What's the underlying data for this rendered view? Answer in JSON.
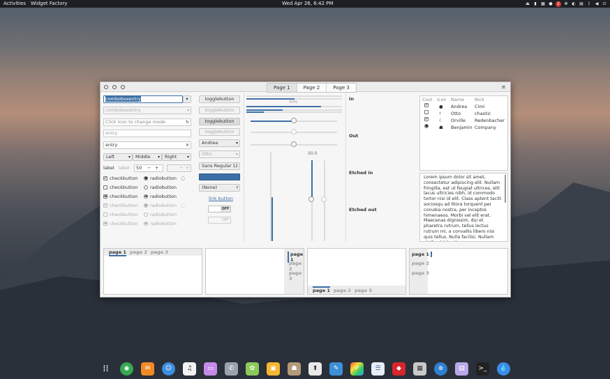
{
  "topbar": {
    "activities": "Activities",
    "app": "Widget Factory",
    "clock": "Wed Apr 26,  6:42 PM",
    "badge": "2"
  },
  "window": {
    "tabs": [
      "Page 1",
      "Page 2",
      "Page 3"
    ],
    "menu": "≡"
  },
  "col1": {
    "combo": "comboboxentry",
    "combo_dis": "comboboxentry",
    "icon_entry": "Click icon to change mode",
    "entry_ph": "entry",
    "entry": "entry",
    "combo_left": "Left",
    "combo_middle": "Middle",
    "combo_right": "Right",
    "label1": "label",
    "label2": "label",
    "spin": "50",
    "minus": "−",
    "plus": "+",
    "checks": [
      "checkbutton",
      "checkbutton",
      "checkbutton",
      "checkbutton",
      "checkbutton",
      "checkbutton"
    ],
    "radios": [
      "radiobutton",
      "radiobutton",
      "radiobutton",
      "radiobutton",
      "radiobutton",
      "radiobutton"
    ]
  },
  "col2": {
    "toggles": [
      "togglebutton",
      "togglebutton",
      "togglebutton",
      "togglebutton"
    ],
    "combo_andrea": "Andrea",
    "combo_otto": "Otto",
    "font": "Sans Regular",
    "font_size": "12",
    "file": "(None)",
    "link": "link button",
    "off1": "OFF",
    "off2": "OFF"
  },
  "col3": {
    "progress_label": "50%",
    "scale_value": "50.0"
  },
  "col4": {
    "frames": [
      "In",
      "Out",
      "Etched in",
      "Etched out"
    ]
  },
  "tree": {
    "headers": [
      "Cool",
      "Icon",
      "Name",
      "Nick"
    ],
    "rows": [
      {
        "cool": "✔",
        "icon": "●",
        "name": "Andrea",
        "nick": "Cimi"
      },
      {
        "cool": "",
        "icon": "!",
        "name": "Otto",
        "nick": "chaotic"
      },
      {
        "cool": "✔",
        "icon": "☾",
        "name": "Orville",
        "nick": "Redenbacher"
      },
      {
        "cool": "●",
        "icon": "☗",
        "name": "Benjamin",
        "nick": "Company"
      }
    ]
  },
  "lorem": "Lorem ipsum dolor sit amet, consectetur adipiscing elit. Nullam fringilla, est ut feugiat ultrices, elit lacus ultricies nibh, id commodo tortor nisi id elit. Class aptent taciti sociosqu ad litora torquent per conubia nostra, per inceptos himenaeos. Morbi vel elit erat. Maecenas dignissim, dui et pharetra rutrum, tellus lectus rutrum mi, a convallis libero nisi quis tellus. Nulla facilisi. Nullam eleifend lobortis",
  "notebooks": {
    "top": [
      "page 1",
      "page 2",
      "page 3"
    ],
    "right": [
      "page 1",
      "page 2",
      "page 3"
    ],
    "bottom": [
      "page 1",
      "page 2",
      "page 3"
    ],
    "left": [
      "page 1",
      "page 2",
      "page 3"
    ]
  },
  "dock": {
    "apps": [
      "apps-grid-icon",
      "browser-icon",
      "messages-icon",
      "chat-icon",
      "music-icon",
      "files-icon",
      "phone-icon",
      "game-icon",
      "store-icon",
      "photos-icon",
      "installer-icon",
      "editor-icon",
      "color-picker-icon",
      "text-editor-icon",
      "git-icon",
      "screenshot-icon",
      "web-icon",
      "notes-icon",
      "terminal-icon",
      "drop-icon"
    ]
  }
}
